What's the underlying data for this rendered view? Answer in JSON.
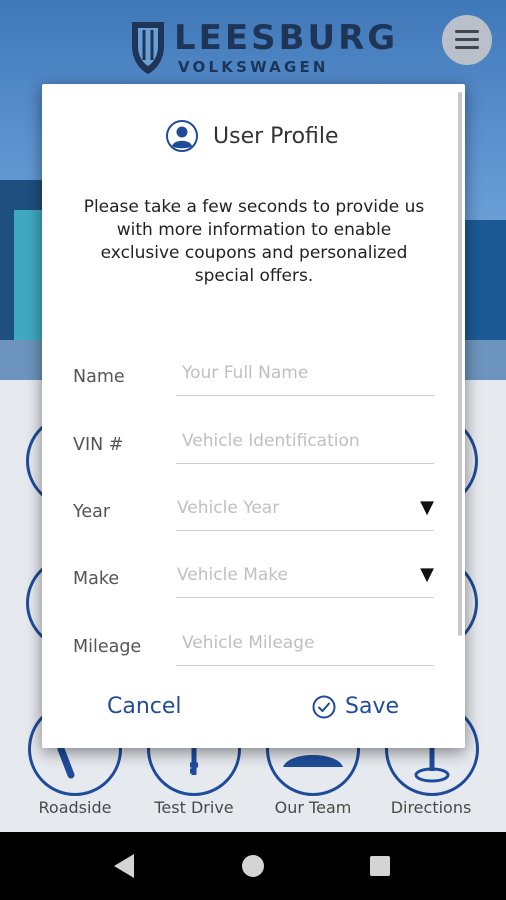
{
  "brand": {
    "name": "LEESBURG",
    "subname": "VOLKSWAGEN"
  },
  "bottom_nav": {
    "items": [
      {
        "label": "Roadside"
      },
      {
        "label": "Test Drive"
      },
      {
        "label": "Our Team"
      },
      {
        "label": "Directions"
      }
    ]
  },
  "dialog": {
    "title": "User Profile",
    "intro": "Please take a few seconds to provide us with more information to enable exclusive coupons and personalized special offers.",
    "fields": {
      "name": {
        "label": "Name",
        "placeholder": "Your Full Name"
      },
      "vin": {
        "label": "VIN #",
        "placeholder": "Vehicle Identification"
      },
      "year": {
        "label": "Year",
        "placeholder": "Vehicle Year"
      },
      "make": {
        "label": "Make",
        "placeholder": "Vehicle Make"
      },
      "mileage": {
        "label": "Mileage",
        "placeholder": "Vehicle Mileage"
      }
    },
    "cancel_label": "Cancel",
    "save_label": "Save"
  },
  "icons": {
    "menu": "menu-icon",
    "user": "user-circle-icon",
    "check": "check-circle-icon",
    "dropdown": "triangle-down-icon",
    "back": "back-icon",
    "home": "home-icon",
    "recents": "recents-icon"
  },
  "colors": {
    "accent": "#1f4c9a",
    "hero": "#5d92cf",
    "dialog_bg": "#ffffff",
    "navbar": "#000000"
  }
}
